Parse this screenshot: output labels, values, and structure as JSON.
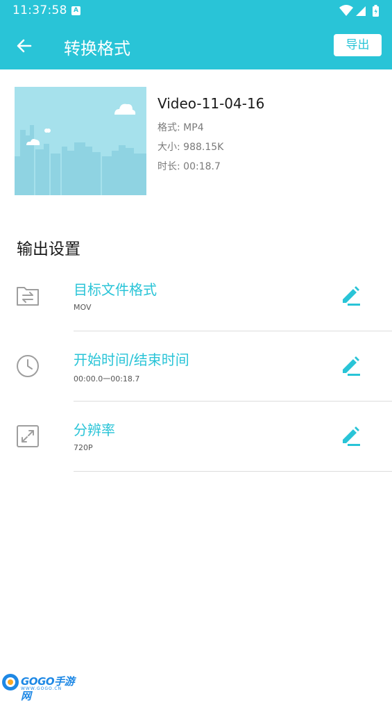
{
  "status_bar": {
    "time": "11:37:58",
    "notification_badge": "A"
  },
  "app_bar": {
    "title": "转换格式",
    "export_label": "导出"
  },
  "video": {
    "name": "Video-11-04-16",
    "format": "格式: MP4",
    "size": "大小: 988.15K",
    "duration": "时长: 00:18.7"
  },
  "output_settings": {
    "title": "输出设置",
    "items": [
      {
        "title": "目标文件格式",
        "value": "MOV",
        "icon": "folder-swap-icon"
      },
      {
        "title": "开始时间/结束时间",
        "value": "00:00.0一00:18.7",
        "icon": "clock-icon"
      },
      {
        "title": "分辨率",
        "value": "720P",
        "icon": "resize-icon"
      }
    ]
  },
  "watermark": {
    "brand": "GOGO手游网",
    "url": "WWW.GOGO.CN"
  },
  "colors": {
    "accent": "#29c4d7",
    "thumb_bg": "#a6e1ec"
  }
}
